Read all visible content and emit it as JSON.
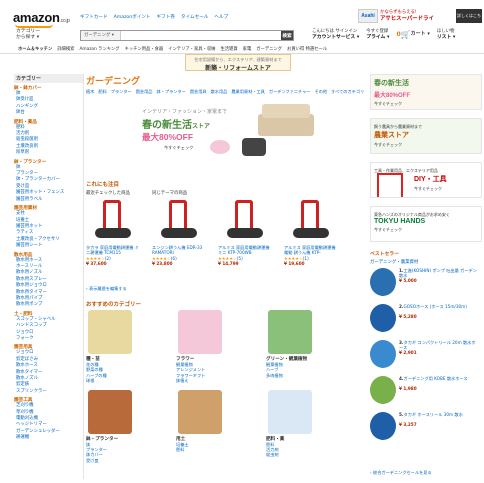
{
  "header": {
    "logo": "amazon",
    "logo_suffix": ".co.jp",
    "links": [
      "ギフトカード",
      "Amazonポイント",
      "ギフト券",
      "タイムセール",
      "ヘルプ"
    ],
    "banner": {
      "brand": "Asahi",
      "text1": "かならずもらえる!",
      "text2": "アサヒスーパードライ",
      "cta": "詳しくはこちら"
    },
    "category_dropdown_line1": "カテゴリー",
    "category_dropdown_line2": "から探す ▾",
    "search_category": "ガーデニング ▾",
    "search_placeholder": "",
    "search_button": "検索",
    "account_line1": "こんにちは サインイン",
    "account_line2": "アカウントサービス ▾",
    "prime_line1": "今すぐ登録",
    "prime_line2": "プライム ▾",
    "cart_count": "0",
    "cart_label": "カート ▾",
    "wishlist_line1": "ほしい物",
    "wishlist_line2": "リスト ▾"
  },
  "navbar": [
    "ホーム＆キッチン",
    "詳細検索",
    "Amazon ランキング",
    "キッチン用品・食器",
    "インテリア・家具・収納",
    "生活雑貨",
    "家電",
    "ガーデニング",
    "お買い得 特選セール"
  ],
  "promo": {
    "line1": "住宅用設備から、エクステリア、建築資材まで",
    "line2": "新築・リフォームストア"
  },
  "sidebar": {
    "header": "カテゴリー",
    "sections": [
      {
        "title": "鉢・鉢カバー",
        "items": [
          "鉢",
          "鉢受け皿",
          "ハンギング",
          "鉢台"
        ]
      },
      {
        "title": "肥料・薬品",
        "items": [
          "肥料",
          "活力剤",
          "殺虫殺菌剤",
          "土壌改良剤",
          "除草剤"
        ]
      },
      {
        "title": "鉢・プランター",
        "items": [
          "鉢",
          "プランター",
          "鉢・プランターカバー",
          "受け皿",
          "園芸用ネット・フェンス",
          "園芸用ラベル"
        ]
      },
      {
        "title": "園芸用資材",
        "items": [
          "支柱",
          "培養土",
          "園芸用ネット",
          "ラティス",
          "土壌改良・アクセサリ",
          "園芸用シート"
        ]
      },
      {
        "title": "散水用品",
        "items": [
          "散水用ホース",
          "ホースリール",
          "散水用ノズル",
          "散水用スプレー",
          "散水用ジョウロ",
          "散水用タイマー",
          "散水用パイプ",
          "散水用ポンプ"
        ]
      },
      {
        "title": "土・肥料",
        "items": [
          "スコップ・シャベル",
          "ハンドスコップ",
          "ジョウロ",
          "フォーク"
        ]
      },
      {
        "title": "園芸用具",
        "items": [
          "ジョウロ",
          "剪定ばさみ",
          "散水ホース",
          "散水タイマー",
          "散水ノズル",
          "剪定鋏",
          "スプリンクラー"
        ]
      },
      {
        "title": "園芸工具",
        "items": [
          "芝刈り機",
          "草刈り機",
          "電動刈込機",
          "ヘッジトリマー",
          "ガーデンシュレッダー",
          "耕運機"
        ]
      }
    ]
  },
  "main": {
    "title": "ガーデニング",
    "tabs": [
      "植木",
      "肥料",
      "プランター",
      "園芸用品",
      "鉢・プランター",
      "園芸用具",
      "散水用品",
      "農業用資材・工具",
      "ガーデンファニチャー",
      "その他",
      "すべてのカテゴリ"
    ],
    "hero": {
      "line1": "インテリア・ファッション・家電まで",
      "line2": "春の新生活",
      "line2b": "ストア",
      "line3": "最大80%OFF",
      "cta": "今すぐチェック"
    },
    "attention_title": "これにも注目",
    "sub_heads": [
      "最近チェックした商品",
      "同じテーマの商品"
    ],
    "products": [
      {
        "name": "タカラ 家庭用電動耕運機 ミニ耕運機 TCM115",
        "stars": "★★★★☆",
        "reviews": "(2)",
        "price": "¥ 37,600"
      },
      {
        "name": "エンジン耕うん機 EDR-33 RAMATORI",
        "stars": "★★★★☆",
        "reviews": "(6)",
        "price": "¥ 23,800"
      },
      {
        "name": "アルミス 家庭用電動耕運機 ミニ KTP-700WB",
        "stars": "★★★★☆",
        "reviews": "(5)",
        "price": "¥ 14,799"
      },
      {
        "name": "アルミス 家庭用電動耕運機 電動 耕うん機 KTP-1000WB",
        "stars": "★★★★☆",
        "reviews": "(1)",
        "price": "¥ 19,600"
      }
    ],
    "more_link": "› 表示履歴を編集する",
    "osusume_title": "おすすめのカテゴリー",
    "categories": [
      {
        "name": "種・苗",
        "links": [
          "花の種",
          "野菜の種",
          "ハーブの種",
          "球根"
        ]
      },
      {
        "name": "フラワー",
        "links": [
          "観葉植物",
          "アレンジメント",
          "フラワーギフト",
          "鉢植え"
        ]
      },
      {
        "name": "グリーン・観葉植物",
        "links": [
          "観葉植物",
          "ハーブ",
          "多肉植物"
        ]
      },
      {
        "name": "鉢・プランター",
        "links": [
          "鉢",
          "プランター",
          "鉢カバー",
          "受け皿"
        ]
      },
      {
        "name": "用土",
        "links": [
          "培養土",
          "肥料"
        ]
      },
      {
        "name": "肥料・薬",
        "links": [
          "肥料",
          "活力剤",
          "殺虫剤"
        ]
      }
    ]
  },
  "right": {
    "ads": [
      {
        "line1": "春の新生活",
        "line2": "ストア",
        "line3": "最大80%OFF",
        "cta": "今すぐチェック"
      },
      {
        "line1": "飼う農具から農業資材まで",
        "line2": "農業ストア",
        "cta": "今すぐチェック"
      },
      {
        "line1": "工具・作業用品、エクステリア用品",
        "line2": "DIY・工具",
        "line3": "ストア",
        "cta": "今すぐチェック"
      },
      {
        "line1": "東急ハンズのオリジナル商品がお求め安く",
        "line2": "TOKYU HANDS",
        "cta": "今すぐチェック"
      }
    ],
    "best_title": "ベストセラー",
    "best_tab": "ガーデニング・農業資材",
    "bestsellers": [
      {
        "rank": "1.",
        "name": "工進(KOSHIN) ポンプ 吐出量 ガーデン散水",
        "price": "¥ 5,000"
      },
      {
        "rank": "2.",
        "name": "GOSOホース (ホース 15m/30m)",
        "price": "¥ 5,280"
      },
      {
        "rank": "3.",
        "name": "タカギ コンパクトリール 20m 散水ホース",
        "price": "¥ 2,901"
      },
      {
        "rank": "4.",
        "name": "ガーデニング用 KOBE 散水ホース",
        "price": "¥ 1,980"
      },
      {
        "rank": "5.",
        "name": "タカギ ホースリール 30m 散水",
        "price": "¥ 3,257"
      }
    ],
    "foot_link": "› 総合ガーデニングセールを見る"
  }
}
